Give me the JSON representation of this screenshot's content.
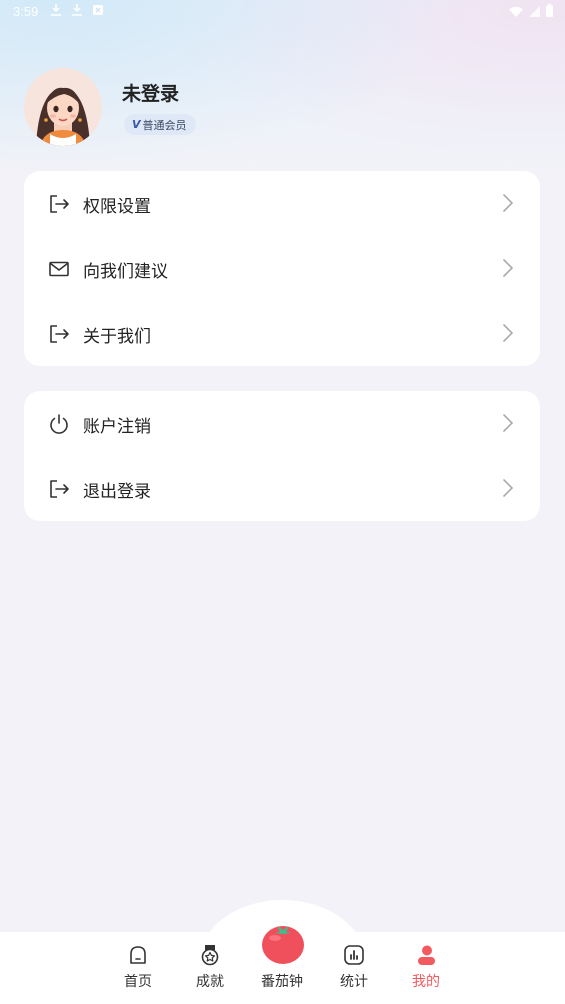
{
  "status_bar": {
    "time": "3:59"
  },
  "profile": {
    "username": "未登录",
    "badge_icon": "V",
    "badge_label": "普通会员"
  },
  "menu_group_1": [
    {
      "label": "权限设置",
      "icon": "exit-arrow-icon"
    },
    {
      "label": "向我们建议",
      "icon": "mail-icon"
    },
    {
      "label": "关于我们",
      "icon": "exit-arrow-icon"
    }
  ],
  "menu_group_2": [
    {
      "label": "账户注销",
      "icon": "power-icon"
    },
    {
      "label": "退出登录",
      "icon": "exit-arrow-icon"
    }
  ],
  "tab_bar": {
    "home": "首页",
    "achievement": "成就",
    "pomodoro": "番茄钟",
    "stats": "统计",
    "mine": "我的",
    "active": "mine"
  },
  "colors": {
    "accent": "#f25a5f",
    "card": "#ffffff",
    "background": "#f2f2f8",
    "badge_bg": "#dfe8f6"
  }
}
